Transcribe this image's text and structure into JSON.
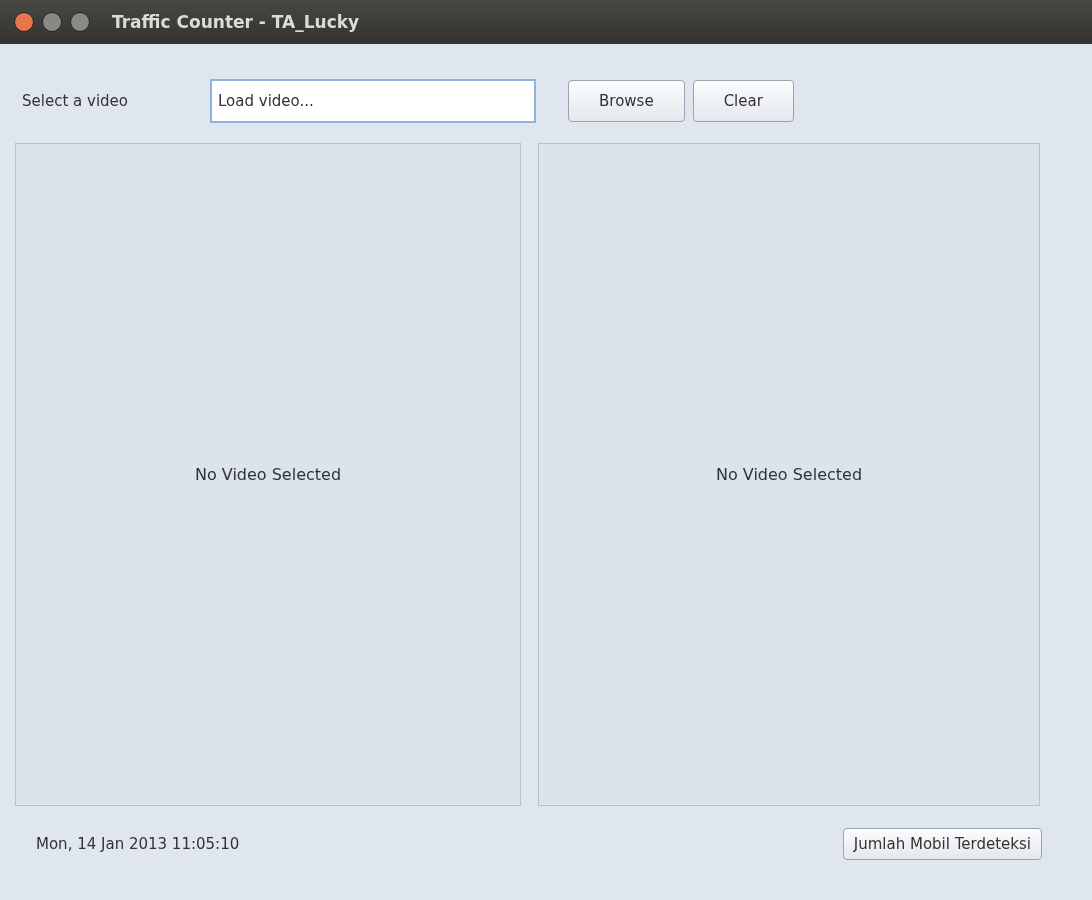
{
  "window": {
    "title": "Traffic Counter - TA_Lucky"
  },
  "video_picker": {
    "label": "Select a video",
    "value": "Load video...",
    "buttons": [
      "Browse",
      "Clear"
    ]
  },
  "panels": [
    {
      "message": "No Video Selected"
    },
    {
      "message": "No Video Selected"
    }
  ],
  "footer": {
    "datetime": "Mon, 14 Jan 2013 11:05:10",
    "button": "Jumlah Mobil Terdeteksi"
  }
}
